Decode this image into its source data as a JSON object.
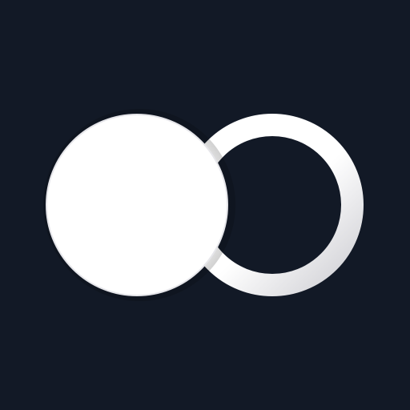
{
  "icon": {
    "name": "app-logo-icon",
    "description_shape": "overlapping-solid-circle-and-ring"
  },
  "colors": {
    "background": "#121926",
    "solid_circle_fill": "#FFFFFF",
    "ring_light": "#FFFFFF",
    "ring_shadow": "#CFCFD4"
  }
}
